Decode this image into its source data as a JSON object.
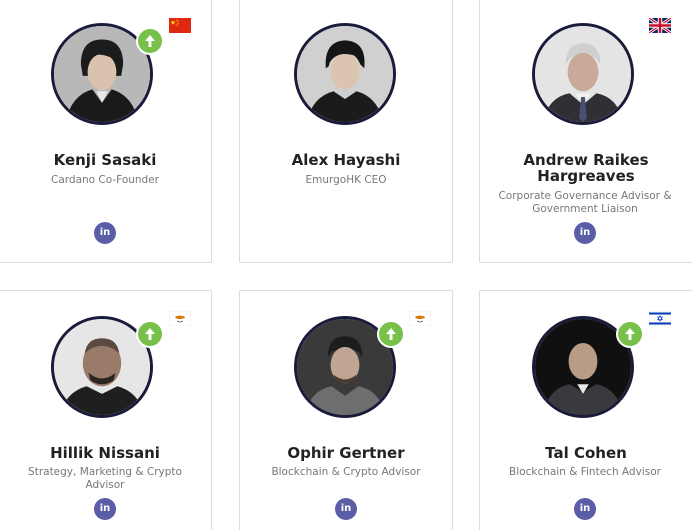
{
  "members": [
    {
      "name": "Kenji Sasaki",
      "role": "Cardano Co-Founder",
      "linkedin_label": "in",
      "flag": "china-flag",
      "badge": "upvote-icon"
    },
    {
      "name": "Alex Hayashi",
      "role": "EmurgoHK CEO",
      "linkedin_label": "in"
    },
    {
      "name": "Andrew Raikes Hargreaves",
      "role": "Corporate Governance Advisor & Government Liaison",
      "linkedin_label": "in",
      "flag": "uk-flag"
    },
    {
      "name": "Hillik Nissani",
      "role": "Strategy, Marketing & Crypto Advisor",
      "linkedin_label": "in",
      "flag": "cyprus-flag",
      "badge": "upvote-icon"
    },
    {
      "name": "Ophir Gertner",
      "role": "Blockchain & Crypto Advisor",
      "linkedin_label": "in",
      "flag": "cyprus-flag",
      "badge": "upvote-icon"
    },
    {
      "name": "Tal Cohen",
      "role": "Blockchain & Fintech Advisor",
      "linkedin_label": "in",
      "flag": "israel-flag",
      "badge": "upvote-icon"
    }
  ],
  "colors": {
    "card_border": "#dcdcdc",
    "avatar_ring": "#181b3a",
    "badge_green": "#77c14a",
    "linkedin_purple": "#5b5ea6",
    "name_text": "#222222",
    "role_text": "#777777"
  }
}
